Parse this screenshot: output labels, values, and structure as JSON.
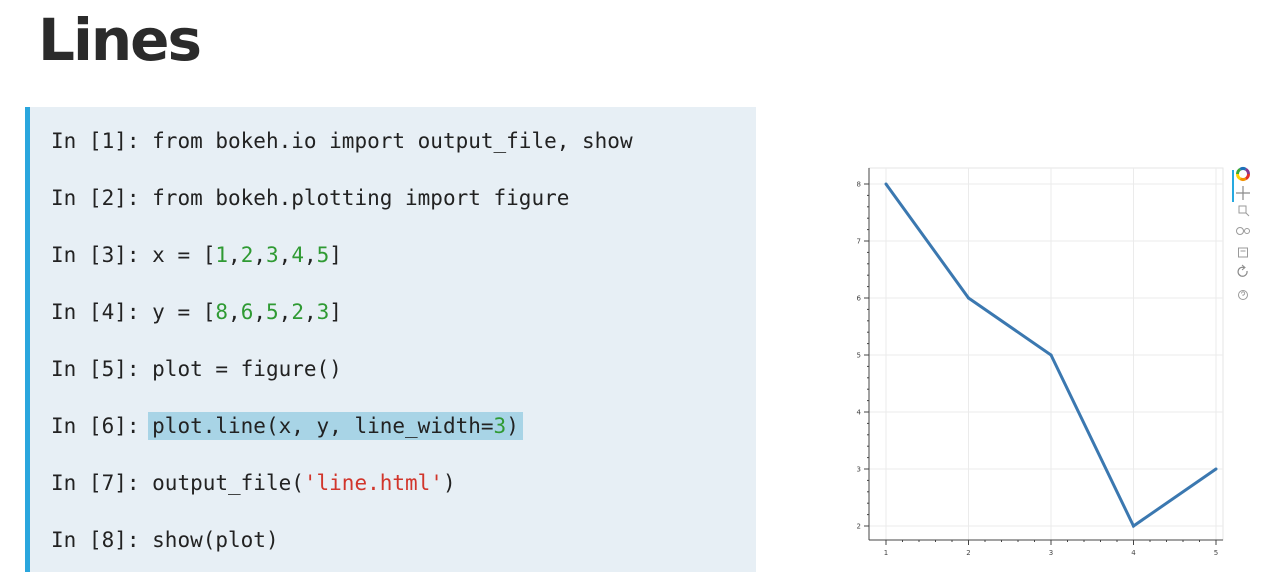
{
  "slide": {
    "title": "Lines"
  },
  "code": {
    "lines": [
      {
        "prompt": "In [1]: ",
        "segments": [
          {
            "text": "from bokeh.io import output_file, show",
            "kind": "plain"
          }
        ]
      },
      {
        "prompt": "In [2]: ",
        "segments": [
          {
            "text": "from bokeh.plotting import figure",
            "kind": "plain"
          }
        ]
      },
      {
        "prompt": "In [3]: ",
        "segments": [
          {
            "text": "x = [",
            "kind": "plain"
          },
          {
            "text": "1",
            "kind": "num"
          },
          {
            "text": ",",
            "kind": "plain"
          },
          {
            "text": "2",
            "kind": "num"
          },
          {
            "text": ",",
            "kind": "plain"
          },
          {
            "text": "3",
            "kind": "num"
          },
          {
            "text": ",",
            "kind": "plain"
          },
          {
            "text": "4",
            "kind": "num"
          },
          {
            "text": ",",
            "kind": "plain"
          },
          {
            "text": "5",
            "kind": "num"
          },
          {
            "text": "]",
            "kind": "plain"
          }
        ]
      },
      {
        "prompt": "In [4]: ",
        "segments": [
          {
            "text": "y = [",
            "kind": "plain"
          },
          {
            "text": "8",
            "kind": "num"
          },
          {
            "text": ",",
            "kind": "plain"
          },
          {
            "text": "6",
            "kind": "num"
          },
          {
            "text": ",",
            "kind": "plain"
          },
          {
            "text": "5",
            "kind": "num"
          },
          {
            "text": ",",
            "kind": "plain"
          },
          {
            "text": "2",
            "kind": "num"
          },
          {
            "text": ",",
            "kind": "plain"
          },
          {
            "text": "3",
            "kind": "num"
          },
          {
            "text": "]",
            "kind": "plain"
          }
        ]
      },
      {
        "prompt": "In [5]: ",
        "segments": [
          {
            "text": "plot = figure()",
            "kind": "plain"
          }
        ]
      },
      {
        "prompt": "In [6]: ",
        "highlight": true,
        "segments": [
          {
            "text": "plot.line(x, y, line_width=",
            "kind": "plain"
          },
          {
            "text": "3",
            "kind": "num"
          },
          {
            "text": ")",
            "kind": "plain"
          }
        ]
      },
      {
        "prompt": "In [7]: ",
        "segments": [
          {
            "text": "output_file(",
            "kind": "plain"
          },
          {
            "text": "'line.html'",
            "kind": "str"
          },
          {
            "text": ")",
            "kind": "plain"
          }
        ]
      },
      {
        "prompt": "In [8]: ",
        "segments": [
          {
            "text": "show(plot)",
            "kind": "plain"
          }
        ]
      }
    ]
  },
  "colors": {
    "line": "#3b78b0",
    "number": "#2f9a33",
    "string": "#d1352b",
    "panel_border": "#2aa6dd"
  },
  "chart_data": {
    "type": "line",
    "title": "",
    "xlabel": "",
    "ylabel": "",
    "x": [
      1,
      2,
      3,
      4,
      5
    ],
    "series": [
      {
        "values": [
          8,
          6,
          5,
          2,
          3
        ]
      }
    ],
    "xlim": [
      1,
      5
    ],
    "ylim": [
      2,
      8
    ],
    "xticks": [
      "1",
      "2",
      "3",
      "4",
      "5"
    ],
    "yticks": [
      "2",
      "3",
      "4",
      "5",
      "6",
      "7",
      "8"
    ],
    "grid": true,
    "legend": "none"
  },
  "toolbar": {
    "tools": [
      {
        "name": "bokeh-logo-icon"
      },
      {
        "name": "pan-icon"
      },
      {
        "name": "zoom-box-icon"
      },
      {
        "name": "wheel-zoom-icon"
      },
      {
        "name": "save-icon"
      },
      {
        "name": "reset-icon"
      },
      {
        "name": "help-icon"
      }
    ]
  }
}
